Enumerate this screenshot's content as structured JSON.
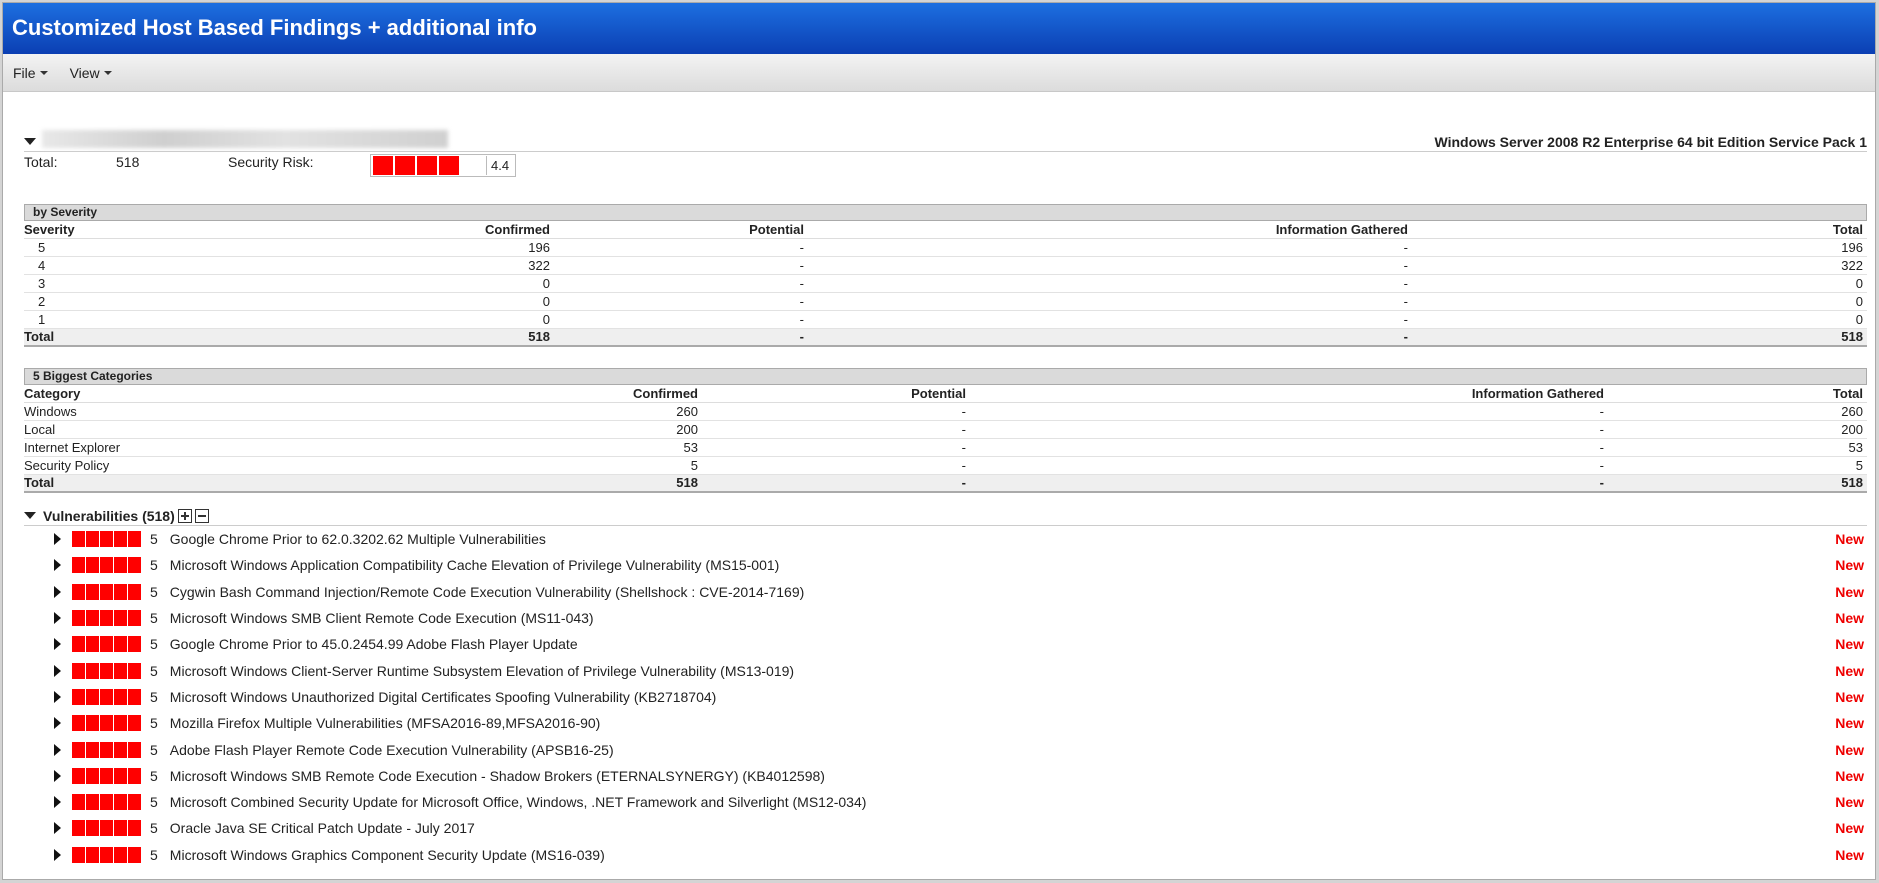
{
  "window": {
    "title": "Customized Host Based Findings + additional info"
  },
  "menu": {
    "file": "File",
    "view": "View"
  },
  "host": {
    "os": "Windows Server 2008 R2 Enterprise 64 bit Edition Service Pack 1",
    "total_label": "Total:",
    "total_value": "518",
    "risk_label": "Security Risk:",
    "risk_score": "4.4",
    "risk_color": "#ff0000"
  },
  "severity": {
    "heading": "by Severity",
    "columns": [
      "Severity",
      "Confirmed",
      "Potential",
      "Information Gathered",
      "Total"
    ],
    "rows": [
      [
        "5",
        "196",
        "-",
        "-",
        "196"
      ],
      [
        "4",
        "322",
        "-",
        "-",
        "322"
      ],
      [
        "3",
        "0",
        "-",
        "-",
        "0"
      ],
      [
        "2",
        "0",
        "-",
        "-",
        "0"
      ],
      [
        "1",
        "0",
        "-",
        "-",
        "0"
      ]
    ],
    "total": [
      "Total",
      "518",
      "-",
      "-",
      "518"
    ]
  },
  "categories": {
    "heading": "5 Biggest Categories",
    "columns": [
      "Category",
      "Confirmed",
      "Potential",
      "Information Gathered",
      "Total"
    ],
    "rows": [
      [
        "Windows",
        "260",
        "-",
        "-",
        "260"
      ],
      [
        "Local",
        "200",
        "-",
        "-",
        "200"
      ],
      [
        "Internet Explorer",
        "53",
        "-",
        "-",
        "53"
      ],
      [
        "Security Policy",
        "5",
        "-",
        "-",
        "5"
      ]
    ],
    "total": [
      "Total",
      "518",
      "-",
      "-",
      "518"
    ]
  },
  "vulnerabilities": {
    "heading": "Vulnerabilities (518)",
    "items": [
      {
        "severity": "5",
        "title": "Google Chrome Prior to 62.0.3202.62 Multiple Vulnerabilities",
        "status": "New"
      },
      {
        "severity": "5",
        "title": "Microsoft Windows Application Compatibility Cache Elevation of Privilege Vulnerability (MS15-001)",
        "status": "New"
      },
      {
        "severity": "5",
        "title": "Cygwin Bash Command Injection/Remote Code Execution Vulnerability (Shellshock : CVE-2014-7169)",
        "status": "New"
      },
      {
        "severity": "5",
        "title": "Microsoft Windows SMB Client Remote Code Execution (MS11-043)",
        "status": "New"
      },
      {
        "severity": "5",
        "title": "Google Chrome Prior to 45.0.2454.99 Adobe Flash Player Update",
        "status": "New"
      },
      {
        "severity": "5",
        "title": "Microsoft Windows Client-Server Runtime Subsystem Elevation of Privilege Vulnerability (MS13-019)",
        "status": "New"
      },
      {
        "severity": "5",
        "title": "Microsoft Windows Unauthorized Digital Certificates Spoofing Vulnerability (KB2718704)",
        "status": "New"
      },
      {
        "severity": "5",
        "title": "Mozilla Firefox Multiple Vulnerabilities (MFSA2016-89,MFSA2016-90)",
        "status": "New"
      },
      {
        "severity": "5",
        "title": "Adobe Flash Player Remote Code Execution Vulnerability (APSB16-25)",
        "status": "New"
      },
      {
        "severity": "5",
        "title": "Microsoft Windows SMB Remote Code Execution - Shadow Brokers (ETERNALSYNERGY) (KB4012598)",
        "status": "New"
      },
      {
        "severity": "5",
        "title": "Microsoft Combined Security Update for Microsoft Office, Windows, .NET Framework and Silverlight (MS12-034)",
        "status": "New"
      },
      {
        "severity": "5",
        "title": "Oracle Java SE Critical Patch Update - July 2017",
        "status": "New"
      },
      {
        "severity": "5",
        "title": "Microsoft Windows Graphics Component Security Update (MS16-039)",
        "status": "New"
      }
    ]
  }
}
